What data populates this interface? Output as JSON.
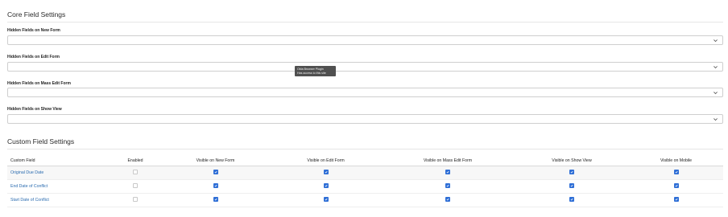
{
  "core": {
    "title": "Core Field Settings",
    "fields": [
      {
        "label": "Hidden Fields on New Form",
        "value": ""
      },
      {
        "label": "Hidden Fields on Edit Form",
        "value": ""
      },
      {
        "label": "Hidden Fields on Mass Edit Form",
        "value": ""
      },
      {
        "label": "Hidden Fields on Show View",
        "value": ""
      }
    ]
  },
  "tooltip": {
    "line1": "Okta Browser Plugin",
    "line2": "Has access to this site"
  },
  "custom": {
    "title": "Custom Field Settings",
    "columns": [
      "Custom Field",
      "Enabled",
      "Visible on New Form",
      "Visible on Edit Form",
      "Visible on Mass Edit Form",
      "Visible on Show View",
      "Visible on Mobile"
    ],
    "rows": [
      {
        "name": "Original Due Date",
        "enabled": false,
        "new_form": true,
        "edit_form": true,
        "mass_edit": true,
        "show_view": true,
        "mobile": true
      },
      {
        "name": "End Date of Conflict",
        "enabled": false,
        "new_form": true,
        "edit_form": true,
        "mass_edit": true,
        "show_view": true,
        "mobile": true
      },
      {
        "name": "Start Date of Conflict",
        "enabled": false,
        "new_form": true,
        "edit_form": true,
        "mass_edit": true,
        "show_view": true,
        "mobile": true
      }
    ]
  },
  "colors": {
    "link": "#2b6cb0",
    "checkbox_on": "#2f6fd6"
  }
}
